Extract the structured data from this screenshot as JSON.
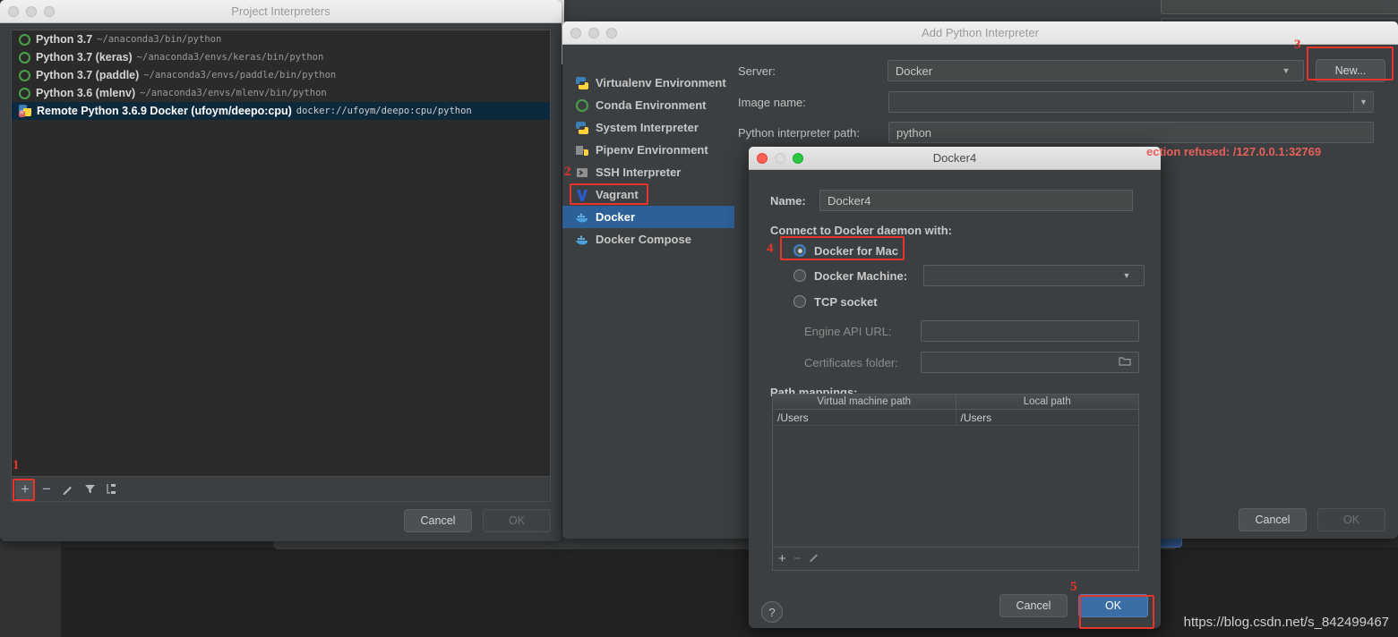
{
  "project_interpreters": {
    "title": "Project Interpreters",
    "interpreters": [
      {
        "name": "Python 3.7",
        "path": "~/anaconda3/bin/python",
        "icon": "conda-circle-icon",
        "selected": false
      },
      {
        "name": "Python 3.7 (keras)",
        "path": "~/anaconda3/envs/keras/bin/python",
        "icon": "conda-circle-icon",
        "selected": false
      },
      {
        "name": "Python 3.7 (paddle)",
        "path": "~/anaconda3/envs/paddle/bin/python",
        "icon": "conda-circle-icon",
        "selected": false
      },
      {
        "name": "Python 3.6 (mlenv)",
        "path": "~/anaconda3/envs/mlenv/bin/python",
        "icon": "conda-circle-icon",
        "selected": false
      },
      {
        "name": "Remote Python 3.6.9 Docker (ufoym/deepo:cpu)",
        "path": "docker://ufoym/deepo:cpu/python",
        "icon": "remote-python-docker-icon",
        "selected": true
      }
    ],
    "toolbar": {
      "add": "+",
      "remove": "−",
      "edit": "✎",
      "filter": "▼",
      "show_paths": "☰"
    },
    "cancel_label": "Cancel",
    "ok_label": "OK"
  },
  "add_python_interpreter": {
    "title": "Add Python Interpreter",
    "environments": [
      {
        "label": "Virtualenv Environment",
        "icon": "python-virtualenv-icon",
        "selected": false
      },
      {
        "label": "Conda Environment",
        "icon": "conda-circle-icon",
        "selected": false
      },
      {
        "label": "System Interpreter",
        "icon": "python-icon",
        "selected": false
      },
      {
        "label": "Pipenv Environment",
        "icon": "pipenv-icon",
        "selected": false
      },
      {
        "label": "SSH Interpreter",
        "icon": "terminal-icon",
        "selected": false
      },
      {
        "label": "Vagrant",
        "icon": "vagrant-icon",
        "selected": false
      },
      {
        "label": "Docker",
        "icon": "docker-whale-icon",
        "selected": true
      },
      {
        "label": "Docker Compose",
        "icon": "docker-compose-icon",
        "selected": false
      }
    ],
    "fields": {
      "server_label": "Server:",
      "server_value": "Docker",
      "image_label": "Image name:",
      "image_value": "",
      "image_placeholder": "",
      "interpreter_path_label": "Python interpreter path:",
      "interpreter_path_value": "python"
    },
    "new_button": "New...",
    "error_text": "ection refused: /127.0.0.1:32769",
    "cancel_label": "Cancel",
    "ok_label": "OK"
  },
  "docker4_dialog": {
    "title": "Docker4",
    "name_label": "Name:",
    "name_value": "Docker4",
    "connect_label": "Connect to Docker daemon with:",
    "options": [
      {
        "label": "Docker for Mac",
        "selected": true
      },
      {
        "label": "Docker Machine:",
        "selected": false
      },
      {
        "label": "TCP socket",
        "selected": false
      }
    ],
    "docker_machine_value": "",
    "engine_api_label": "Engine API URL:",
    "engine_api_value": "",
    "certificates_label": "Certificates folder:",
    "certificates_value": "",
    "path_mappings_label": "Path mappings:",
    "path_mappings_columns": [
      "Virtual machine path",
      "Local path"
    ],
    "path_mappings_rows": [
      {
        "vm": "/Users",
        "local": "/Users"
      }
    ],
    "pm_toolbar": {
      "add": "+",
      "remove": "−",
      "edit": "✎"
    },
    "help_label": "?",
    "cancel_label": "Cancel",
    "ok_label": "OK"
  },
  "annotations": {
    "step1": "1",
    "step2": "2",
    "step3": "3",
    "step4": "4",
    "step5": "5"
  },
  "watermark": "https://blog.csdn.net/s_842499467",
  "colors": {
    "accent_blue": "#2d6099",
    "primary_button": "#3b6ea5",
    "annotation_red": "#e8352b",
    "error_red": "#e8605a",
    "window_bg": "#3c3f41",
    "list_bg": "#2b2b2b",
    "selection_navy": "#0d293e"
  }
}
